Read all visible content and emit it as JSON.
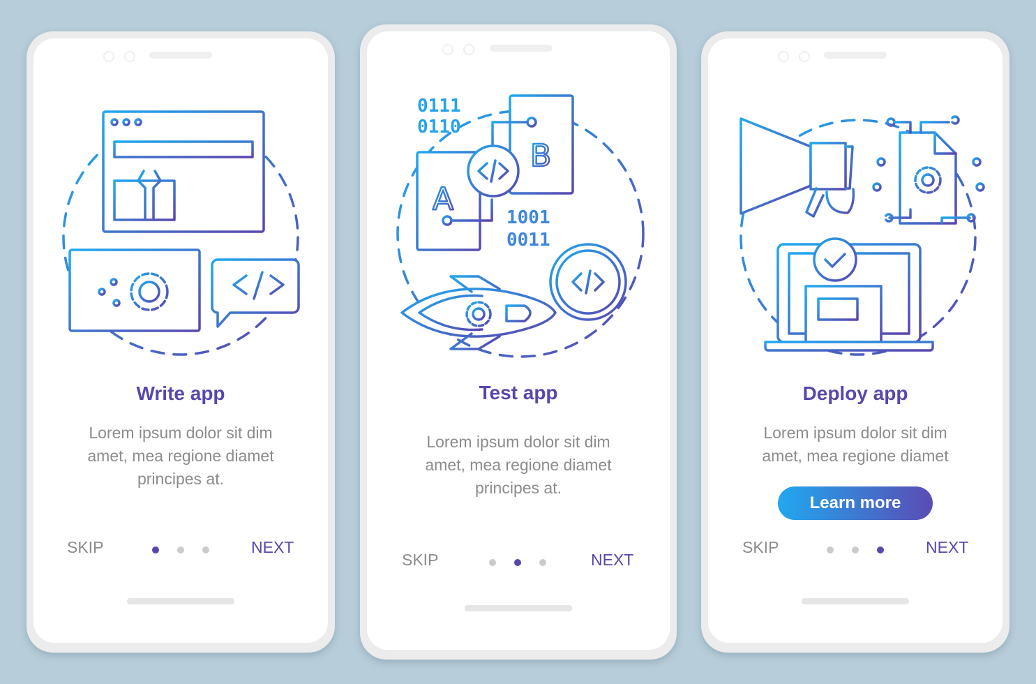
{
  "screens": [
    {
      "title": "Write app",
      "description_lines": [
        "Lorem ipsum dolor sit dim",
        "amet, mea regione diamet",
        "principes at."
      ],
      "skip_label": "SKIP",
      "next_label": "NEXT",
      "active_page": 1,
      "page_count": 3,
      "illustration": "write-app-illustration"
    },
    {
      "title": "Test app",
      "description_lines": [
        "Lorem ipsum dolor sit dim",
        "amet, mea regione diamet",
        "principes at."
      ],
      "skip_label": "SKIP",
      "next_label": "NEXT",
      "active_page": 2,
      "page_count": 3,
      "illustration": "test-app-illustration",
      "binary_top": [
        "0111",
        "0110"
      ],
      "binary_bottom": [
        "1001",
        "0011"
      ],
      "letter_a": "A",
      "letter_b": "B"
    },
    {
      "title": "Deploy app",
      "description_lines": [
        "Lorem ipsum dolor sit dim",
        "amet, mea regione diamet"
      ],
      "button_label": "Learn more",
      "skip_label": "SKIP",
      "next_label": "NEXT",
      "active_page": 3,
      "page_count": 3,
      "illustration": "deploy-app-illustration"
    }
  ],
  "colors": {
    "background": "#b7cdd9",
    "accent": "#5548ad",
    "gradient_start": "#20a8ef",
    "gradient_end": "#5a4cb4",
    "muted_text": "#8c8c8c"
  }
}
